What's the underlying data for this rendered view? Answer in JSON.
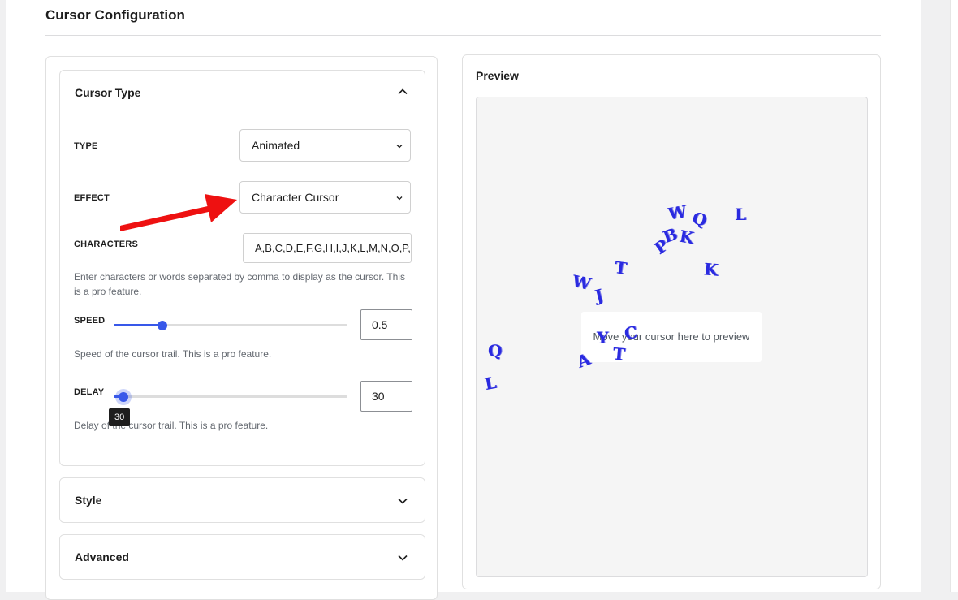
{
  "page": {
    "title": "Cursor Configuration"
  },
  "left": {
    "cursor_type_panel": {
      "title": "Cursor Type",
      "type": {
        "label": "TYPE",
        "value": "Animated"
      },
      "effect": {
        "label": "EFFECT",
        "value": "Character Cursor"
      },
      "characters": {
        "label": "CHARACTERS",
        "value": "A,B,C,D,E,F,G,H,I,J,K,L,M,N,O,P,Q,R,S,T,U,V,W,X,Y,Z",
        "help": "Enter characters or words separated by comma to display as the cursor. This is a pro feature."
      },
      "speed": {
        "label": "SPEED",
        "value": "0.5",
        "fraction": 0.21,
        "help": "Speed of the cursor trail. This is a pro feature."
      },
      "delay": {
        "label": "DELAY",
        "value": "30",
        "fraction": 0.04,
        "tooltip": "30",
        "help": "Delay of the cursor trail. This is a pro feature."
      }
    },
    "style_panel": {
      "title": "Style"
    },
    "advanced_panel": {
      "title": "Advanced"
    }
  },
  "preview": {
    "title": "Preview",
    "hint": "Move your cursor here to preview",
    "chars": [
      "W",
      "Q",
      "L",
      "B",
      "K",
      "P",
      "T",
      "K",
      "W",
      "J",
      "C",
      "Y",
      "A",
      "T",
      "Q",
      "L"
    ]
  },
  "colors": {
    "accent": "#3858e9",
    "char_color": "#2a2ae0",
    "arrow": "#ee1111"
  }
}
